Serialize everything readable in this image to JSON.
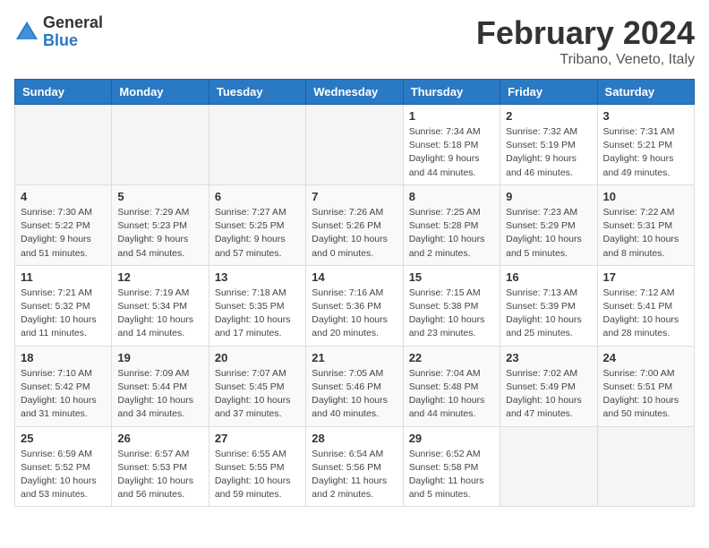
{
  "header": {
    "logo_general": "General",
    "logo_blue": "Blue",
    "month": "February 2024",
    "location": "Tribano, Veneto, Italy"
  },
  "days_of_week": [
    "Sunday",
    "Monday",
    "Tuesday",
    "Wednesday",
    "Thursday",
    "Friday",
    "Saturday"
  ],
  "weeks": [
    [
      {
        "day": "",
        "info": ""
      },
      {
        "day": "",
        "info": ""
      },
      {
        "day": "",
        "info": ""
      },
      {
        "day": "",
        "info": ""
      },
      {
        "day": "1",
        "info": "Sunrise: 7:34 AM\nSunset: 5:18 PM\nDaylight: 9 hours\nand 44 minutes."
      },
      {
        "day": "2",
        "info": "Sunrise: 7:32 AM\nSunset: 5:19 PM\nDaylight: 9 hours\nand 46 minutes."
      },
      {
        "day": "3",
        "info": "Sunrise: 7:31 AM\nSunset: 5:21 PM\nDaylight: 9 hours\nand 49 minutes."
      }
    ],
    [
      {
        "day": "4",
        "info": "Sunrise: 7:30 AM\nSunset: 5:22 PM\nDaylight: 9 hours\nand 51 minutes."
      },
      {
        "day": "5",
        "info": "Sunrise: 7:29 AM\nSunset: 5:23 PM\nDaylight: 9 hours\nand 54 minutes."
      },
      {
        "day": "6",
        "info": "Sunrise: 7:27 AM\nSunset: 5:25 PM\nDaylight: 9 hours\nand 57 minutes."
      },
      {
        "day": "7",
        "info": "Sunrise: 7:26 AM\nSunset: 5:26 PM\nDaylight: 10 hours\nand 0 minutes."
      },
      {
        "day": "8",
        "info": "Sunrise: 7:25 AM\nSunset: 5:28 PM\nDaylight: 10 hours\nand 2 minutes."
      },
      {
        "day": "9",
        "info": "Sunrise: 7:23 AM\nSunset: 5:29 PM\nDaylight: 10 hours\nand 5 minutes."
      },
      {
        "day": "10",
        "info": "Sunrise: 7:22 AM\nSunset: 5:31 PM\nDaylight: 10 hours\nand 8 minutes."
      }
    ],
    [
      {
        "day": "11",
        "info": "Sunrise: 7:21 AM\nSunset: 5:32 PM\nDaylight: 10 hours\nand 11 minutes."
      },
      {
        "day": "12",
        "info": "Sunrise: 7:19 AM\nSunset: 5:34 PM\nDaylight: 10 hours\nand 14 minutes."
      },
      {
        "day": "13",
        "info": "Sunrise: 7:18 AM\nSunset: 5:35 PM\nDaylight: 10 hours\nand 17 minutes."
      },
      {
        "day": "14",
        "info": "Sunrise: 7:16 AM\nSunset: 5:36 PM\nDaylight: 10 hours\nand 20 minutes."
      },
      {
        "day": "15",
        "info": "Sunrise: 7:15 AM\nSunset: 5:38 PM\nDaylight: 10 hours\nand 23 minutes."
      },
      {
        "day": "16",
        "info": "Sunrise: 7:13 AM\nSunset: 5:39 PM\nDaylight: 10 hours\nand 25 minutes."
      },
      {
        "day": "17",
        "info": "Sunrise: 7:12 AM\nSunset: 5:41 PM\nDaylight: 10 hours\nand 28 minutes."
      }
    ],
    [
      {
        "day": "18",
        "info": "Sunrise: 7:10 AM\nSunset: 5:42 PM\nDaylight: 10 hours\nand 31 minutes."
      },
      {
        "day": "19",
        "info": "Sunrise: 7:09 AM\nSunset: 5:44 PM\nDaylight: 10 hours\nand 34 minutes."
      },
      {
        "day": "20",
        "info": "Sunrise: 7:07 AM\nSunset: 5:45 PM\nDaylight: 10 hours\nand 37 minutes."
      },
      {
        "day": "21",
        "info": "Sunrise: 7:05 AM\nSunset: 5:46 PM\nDaylight: 10 hours\nand 40 minutes."
      },
      {
        "day": "22",
        "info": "Sunrise: 7:04 AM\nSunset: 5:48 PM\nDaylight: 10 hours\nand 44 minutes."
      },
      {
        "day": "23",
        "info": "Sunrise: 7:02 AM\nSunset: 5:49 PM\nDaylight: 10 hours\nand 47 minutes."
      },
      {
        "day": "24",
        "info": "Sunrise: 7:00 AM\nSunset: 5:51 PM\nDaylight: 10 hours\nand 50 minutes."
      }
    ],
    [
      {
        "day": "25",
        "info": "Sunrise: 6:59 AM\nSunset: 5:52 PM\nDaylight: 10 hours\nand 53 minutes."
      },
      {
        "day": "26",
        "info": "Sunrise: 6:57 AM\nSunset: 5:53 PM\nDaylight: 10 hours\nand 56 minutes."
      },
      {
        "day": "27",
        "info": "Sunrise: 6:55 AM\nSunset: 5:55 PM\nDaylight: 10 hours\nand 59 minutes."
      },
      {
        "day": "28",
        "info": "Sunrise: 6:54 AM\nSunset: 5:56 PM\nDaylight: 11 hours\nand 2 minutes."
      },
      {
        "day": "29",
        "info": "Sunrise: 6:52 AM\nSunset: 5:58 PM\nDaylight: 11 hours\nand 5 minutes."
      },
      {
        "day": "",
        "info": ""
      },
      {
        "day": "",
        "info": ""
      }
    ]
  ]
}
